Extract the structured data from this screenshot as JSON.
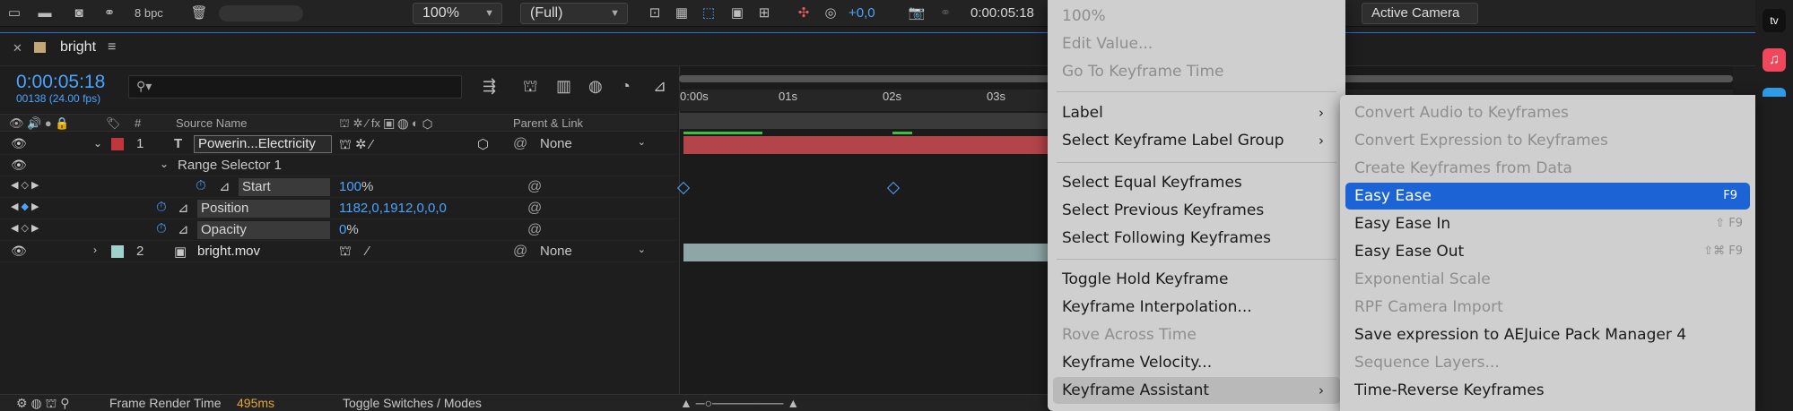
{
  "toolbar": {
    "bpc": "8 bpc",
    "zoom": "100%",
    "resolution": "(Full)",
    "exposure": "+0,0",
    "timecode": "0:00:05:18",
    "camera": "Active Camera"
  },
  "comp": {
    "tab": "bright",
    "timecode": "0:00:05:18",
    "fps": "00138 (24.00 fps)",
    "columns": {
      "number": "#",
      "source": "Source Name",
      "parent": "Parent & Link"
    }
  },
  "layers": [
    {
      "num": "1",
      "name": "Powerin...Electricity",
      "parent": "None"
    },
    {
      "num": "2",
      "name": "bright.mov",
      "parent": "None"
    }
  ],
  "params": {
    "range_selector": "Range Selector 1",
    "start_label": "Start",
    "start_value": "100",
    "start_unit": "%",
    "position_label": "Position",
    "position_value": "1182,0,1912,0,0,0",
    "opacity_label": "Opacity",
    "opacity_value": "0",
    "opacity_unit": "%"
  },
  "ruler": [
    "0:00s",
    "01s",
    "02s",
    "03s"
  ],
  "bottom": {
    "frame_render_label": "Frame Render Time",
    "frame_render_value": "495ms",
    "toggle": "Toggle Switches / Modes"
  },
  "menu": {
    "items": [
      {
        "label": "100%",
        "disabled": true
      },
      {
        "label": "Edit Value...",
        "disabled": true
      },
      {
        "label": "Go To Keyframe Time",
        "disabled": true
      },
      {
        "label": "Label",
        "disabled": false,
        "submenu": true
      },
      {
        "label": "Select Keyframe Label Group",
        "disabled": false,
        "submenu": true
      },
      {
        "label": "Select Equal Keyframes",
        "disabled": false
      },
      {
        "label": "Select Previous Keyframes",
        "disabled": false
      },
      {
        "label": "Select Following Keyframes",
        "disabled": false
      },
      {
        "label": "Toggle Hold Keyframe",
        "disabled": false
      },
      {
        "label": "Keyframe Interpolation...",
        "disabled": false
      },
      {
        "label": "Rove Across Time",
        "disabled": true
      },
      {
        "label": "Keyframe Velocity...",
        "disabled": false
      },
      {
        "label": "Keyframe Assistant",
        "disabled": false,
        "submenu": true,
        "active": true
      }
    ]
  },
  "submenu": {
    "items": [
      {
        "label": "Convert Audio to Keyframes",
        "disabled": true,
        "shortcut": ""
      },
      {
        "label": "Convert Expression to Keyframes",
        "disabled": true,
        "shortcut": ""
      },
      {
        "label": "Create Keyframes from Data",
        "disabled": true,
        "shortcut": ""
      },
      {
        "label": "Easy Ease",
        "disabled": false,
        "shortcut": "F9",
        "highlight": true
      },
      {
        "label": "Easy Ease In",
        "disabled": false,
        "shortcut": "⇧ F9"
      },
      {
        "label": "Easy Ease Out",
        "disabled": false,
        "shortcut": "⇧⌘ F9"
      },
      {
        "label": "Exponential Scale",
        "disabled": true,
        "shortcut": ""
      },
      {
        "label": "RPF Camera Import",
        "disabled": true,
        "shortcut": ""
      },
      {
        "label": "Save expression to AEJuice Pack Manager 4",
        "disabled": false,
        "shortcut": ""
      },
      {
        "label": "Sequence Layers...",
        "disabled": true,
        "shortcut": ""
      },
      {
        "label": "Time-Reverse Keyframes",
        "disabled": false,
        "shortcut": ""
      }
    ]
  },
  "colors": {
    "accent": "#1c64d6",
    "timecode": "#4aa3ff",
    "layer1_bar": "#b3444a",
    "layer2_bar": "#8fa6a6",
    "label_red": "#c0363c",
    "label_teal": "#9fd2ca"
  }
}
